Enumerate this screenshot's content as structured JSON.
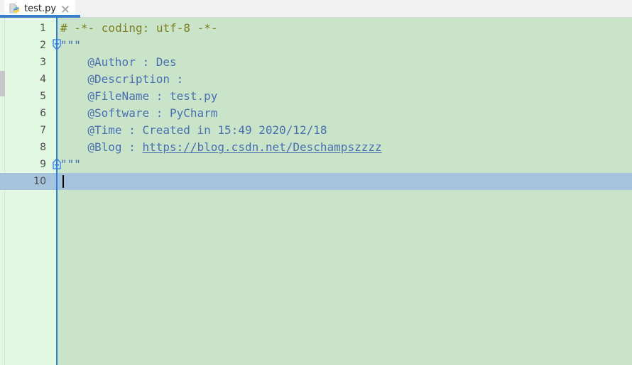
{
  "window": {
    "app": "PyCharm Editor",
    "background": "#f2f2f2"
  },
  "tabbar": {
    "tabs": [
      {
        "label": "test.py",
        "icon": "python-file-icon",
        "active": true,
        "close_label": "×"
      }
    ],
    "active_underline_color": "#3a7ecb"
  },
  "editor": {
    "background": "#c9e4c9",
    "gutter_background": "#e2f8e2",
    "gutter_rule_color": "#2d7ee0",
    "current_line_highlight": "#a6c3dd",
    "caret_line": 10,
    "comment_color": "#7f7f22",
    "string_color": "#4a6fb0",
    "linenumber_color": "#4e4e4e",
    "lines": [
      {
        "n": "1",
        "indent": 0,
        "type": "comment",
        "text": "# -*- coding: utf-8 -*-",
        "fold": ""
      },
      {
        "n": "2",
        "indent": 0,
        "type": "string",
        "text": "\"\"\"",
        "fold": "fold-start"
      },
      {
        "n": "3",
        "indent": 4,
        "type": "string",
        "text": "@Author : Des",
        "fold": ""
      },
      {
        "n": "4",
        "indent": 4,
        "type": "string",
        "text": "@Description :",
        "fold": ""
      },
      {
        "n": "5",
        "indent": 4,
        "type": "string",
        "text": "@FileName : test.py",
        "fold": ""
      },
      {
        "n": "6",
        "indent": 4,
        "type": "string",
        "text": "@Software : PyCharm",
        "fold": ""
      },
      {
        "n": "7",
        "indent": 4,
        "type": "string",
        "text": "@Time : Created in 15:49 2020/12/18",
        "fold": ""
      },
      {
        "n": "8",
        "indent": 4,
        "type": "string",
        "text": "@Blog : ",
        "link": "https://blog.csdn.net/Deschampszzzz",
        "fold": ""
      },
      {
        "n": "9",
        "indent": 0,
        "type": "string",
        "text": "\"\"\"",
        "fold": "fold-end"
      },
      {
        "n": "10",
        "indent": 0,
        "type": "plain",
        "text": "",
        "fold": "",
        "current": true
      }
    ]
  }
}
